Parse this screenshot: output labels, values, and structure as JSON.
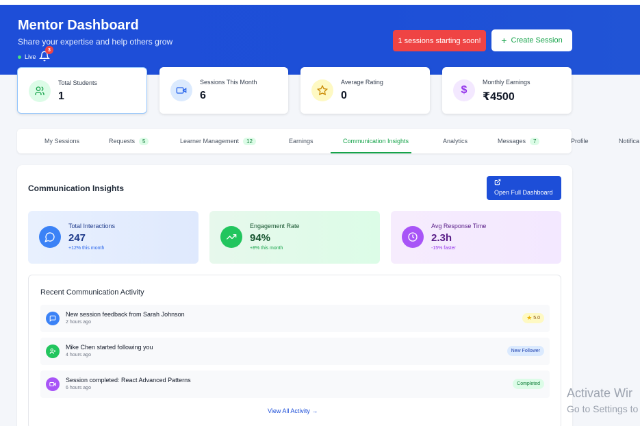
{
  "header": {
    "title": "Mentor Dashboard",
    "subtitle": "Share your expertise and help others grow",
    "live_label": "Live",
    "notification_count": "3",
    "alert_label": "1 sessions starting soon!",
    "create_label": "Create Session",
    "bg_color": "#1e4ed8"
  },
  "stats": [
    {
      "label": "Total Students",
      "value": "1",
      "icon": "users-icon"
    },
    {
      "label": "Sessions This Month",
      "value": "6",
      "icon": "video-icon"
    },
    {
      "label": "Average Rating",
      "value": "0",
      "icon": "star-icon"
    },
    {
      "label": "Monthly Earnings",
      "value": "₹4500",
      "icon": "dollar-icon"
    }
  ],
  "tabs": [
    {
      "label": "My Sessions"
    },
    {
      "label": "Requests",
      "count": "5"
    },
    {
      "label": "Learner Management",
      "count": "12"
    },
    {
      "label": "Earnings"
    },
    {
      "label": "Communication Insights"
    },
    {
      "label": "Analytics"
    },
    {
      "label": "Messages",
      "count": "7"
    },
    {
      "label": "Profile"
    },
    {
      "label": "Notifica"
    }
  ],
  "panel": {
    "title": "Communication Insights",
    "open_label": "Open Full Dashboard",
    "metrics": [
      {
        "label": "Total Interactions",
        "value": "247",
        "sub": "+12% this month",
        "icon": "chat-icon"
      },
      {
        "label": "Engagement Rate",
        "value": "94%",
        "sub": "+8% this month",
        "icon": "trending-up-icon"
      },
      {
        "label": "Avg Response Time",
        "value": "2.3h",
        "sub": "-15% faster",
        "icon": "clock-icon"
      }
    ]
  },
  "activity": {
    "title": "Recent Communication Activity",
    "items": [
      {
        "text": "New session feedback from Sarah Johnson",
        "time": "2 hours ago",
        "badge": "5.0",
        "icon": "message-icon"
      },
      {
        "text": "Mike Chen started following you",
        "time": "4 hours ago",
        "badge": "New Follower",
        "icon": "user-plus-icon"
      },
      {
        "text": "Session completed: React Advanced Patterns",
        "time": "6 hours ago",
        "badge": "Completed",
        "icon": "video-icon"
      }
    ],
    "view_all": "View All Activity →"
  },
  "watermark": {
    "line1": "Activate Wir",
    "line2": "Go to Settings to"
  }
}
